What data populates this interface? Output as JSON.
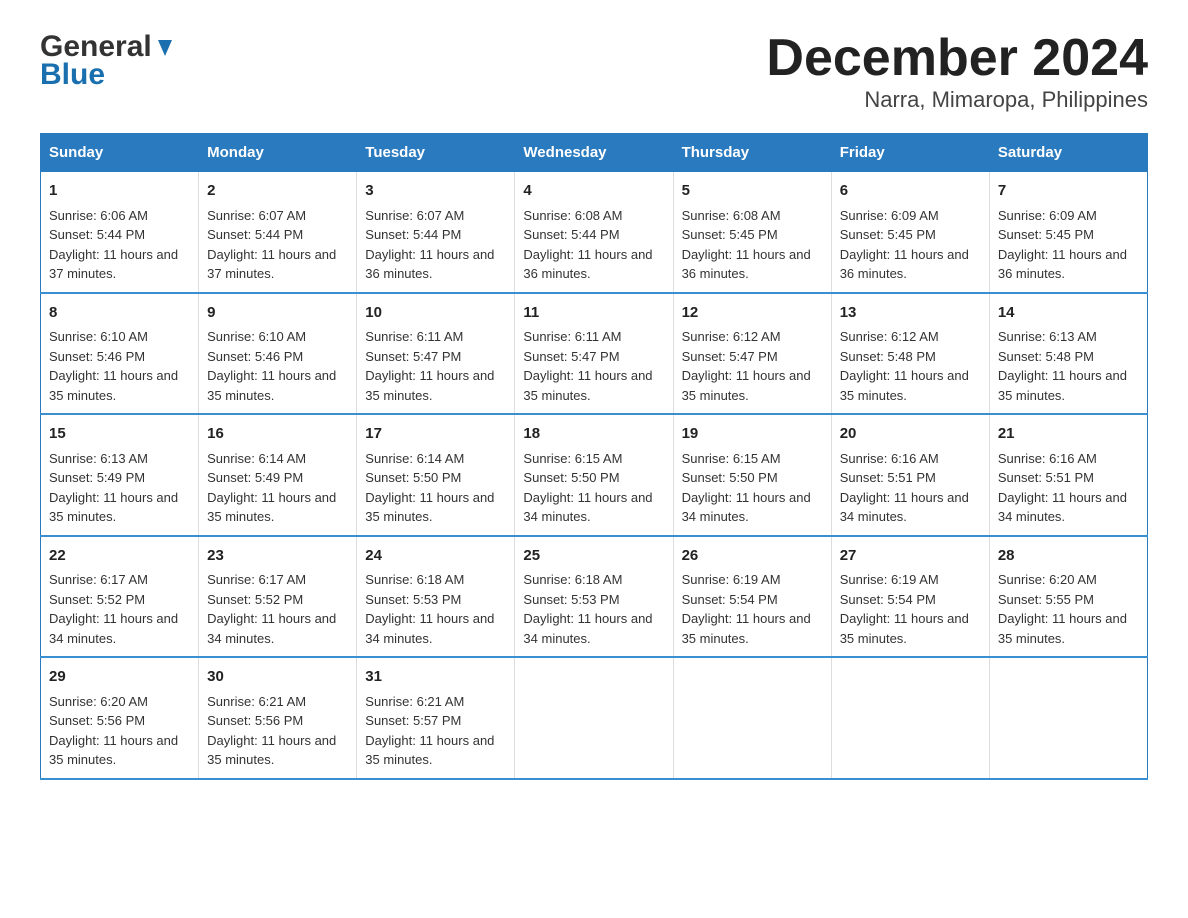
{
  "logo": {
    "general": "General",
    "blue": "Blue"
  },
  "title": "December 2024",
  "subtitle": "Narra, Mimaropa, Philippines",
  "days_of_week": [
    "Sunday",
    "Monday",
    "Tuesday",
    "Wednesday",
    "Thursday",
    "Friday",
    "Saturday"
  ],
  "weeks": [
    [
      {
        "day": "1",
        "sunrise": "6:06 AM",
        "sunset": "5:44 PM",
        "daylight": "11 hours and 37 minutes."
      },
      {
        "day": "2",
        "sunrise": "6:07 AM",
        "sunset": "5:44 PM",
        "daylight": "11 hours and 37 minutes."
      },
      {
        "day": "3",
        "sunrise": "6:07 AM",
        "sunset": "5:44 PM",
        "daylight": "11 hours and 36 minutes."
      },
      {
        "day": "4",
        "sunrise": "6:08 AM",
        "sunset": "5:44 PM",
        "daylight": "11 hours and 36 minutes."
      },
      {
        "day": "5",
        "sunrise": "6:08 AM",
        "sunset": "5:45 PM",
        "daylight": "11 hours and 36 minutes."
      },
      {
        "day": "6",
        "sunrise": "6:09 AM",
        "sunset": "5:45 PM",
        "daylight": "11 hours and 36 minutes."
      },
      {
        "day": "7",
        "sunrise": "6:09 AM",
        "sunset": "5:45 PM",
        "daylight": "11 hours and 36 minutes."
      }
    ],
    [
      {
        "day": "8",
        "sunrise": "6:10 AM",
        "sunset": "5:46 PM",
        "daylight": "11 hours and 35 minutes."
      },
      {
        "day": "9",
        "sunrise": "6:10 AM",
        "sunset": "5:46 PM",
        "daylight": "11 hours and 35 minutes."
      },
      {
        "day": "10",
        "sunrise": "6:11 AM",
        "sunset": "5:47 PM",
        "daylight": "11 hours and 35 minutes."
      },
      {
        "day": "11",
        "sunrise": "6:11 AM",
        "sunset": "5:47 PM",
        "daylight": "11 hours and 35 minutes."
      },
      {
        "day": "12",
        "sunrise": "6:12 AM",
        "sunset": "5:47 PM",
        "daylight": "11 hours and 35 minutes."
      },
      {
        "day": "13",
        "sunrise": "6:12 AM",
        "sunset": "5:48 PM",
        "daylight": "11 hours and 35 minutes."
      },
      {
        "day": "14",
        "sunrise": "6:13 AM",
        "sunset": "5:48 PM",
        "daylight": "11 hours and 35 minutes."
      }
    ],
    [
      {
        "day": "15",
        "sunrise": "6:13 AM",
        "sunset": "5:49 PM",
        "daylight": "11 hours and 35 minutes."
      },
      {
        "day": "16",
        "sunrise": "6:14 AM",
        "sunset": "5:49 PM",
        "daylight": "11 hours and 35 minutes."
      },
      {
        "day": "17",
        "sunrise": "6:14 AM",
        "sunset": "5:50 PM",
        "daylight": "11 hours and 35 minutes."
      },
      {
        "day": "18",
        "sunrise": "6:15 AM",
        "sunset": "5:50 PM",
        "daylight": "11 hours and 34 minutes."
      },
      {
        "day": "19",
        "sunrise": "6:15 AM",
        "sunset": "5:50 PM",
        "daylight": "11 hours and 34 minutes."
      },
      {
        "day": "20",
        "sunrise": "6:16 AM",
        "sunset": "5:51 PM",
        "daylight": "11 hours and 34 minutes."
      },
      {
        "day": "21",
        "sunrise": "6:16 AM",
        "sunset": "5:51 PM",
        "daylight": "11 hours and 34 minutes."
      }
    ],
    [
      {
        "day": "22",
        "sunrise": "6:17 AM",
        "sunset": "5:52 PM",
        "daylight": "11 hours and 34 minutes."
      },
      {
        "day": "23",
        "sunrise": "6:17 AM",
        "sunset": "5:52 PM",
        "daylight": "11 hours and 34 minutes."
      },
      {
        "day": "24",
        "sunrise": "6:18 AM",
        "sunset": "5:53 PM",
        "daylight": "11 hours and 34 minutes."
      },
      {
        "day": "25",
        "sunrise": "6:18 AM",
        "sunset": "5:53 PM",
        "daylight": "11 hours and 34 minutes."
      },
      {
        "day": "26",
        "sunrise": "6:19 AM",
        "sunset": "5:54 PM",
        "daylight": "11 hours and 35 minutes."
      },
      {
        "day": "27",
        "sunrise": "6:19 AM",
        "sunset": "5:54 PM",
        "daylight": "11 hours and 35 minutes."
      },
      {
        "day": "28",
        "sunrise": "6:20 AM",
        "sunset": "5:55 PM",
        "daylight": "11 hours and 35 minutes."
      }
    ],
    [
      {
        "day": "29",
        "sunrise": "6:20 AM",
        "sunset": "5:56 PM",
        "daylight": "11 hours and 35 minutes."
      },
      {
        "day": "30",
        "sunrise": "6:21 AM",
        "sunset": "5:56 PM",
        "daylight": "11 hours and 35 minutes."
      },
      {
        "day": "31",
        "sunrise": "6:21 AM",
        "sunset": "5:57 PM",
        "daylight": "11 hours and 35 minutes."
      },
      null,
      null,
      null,
      null
    ]
  ],
  "labels": {
    "sunrise": "Sunrise:",
    "sunset": "Sunset:",
    "daylight": "Daylight:"
  }
}
